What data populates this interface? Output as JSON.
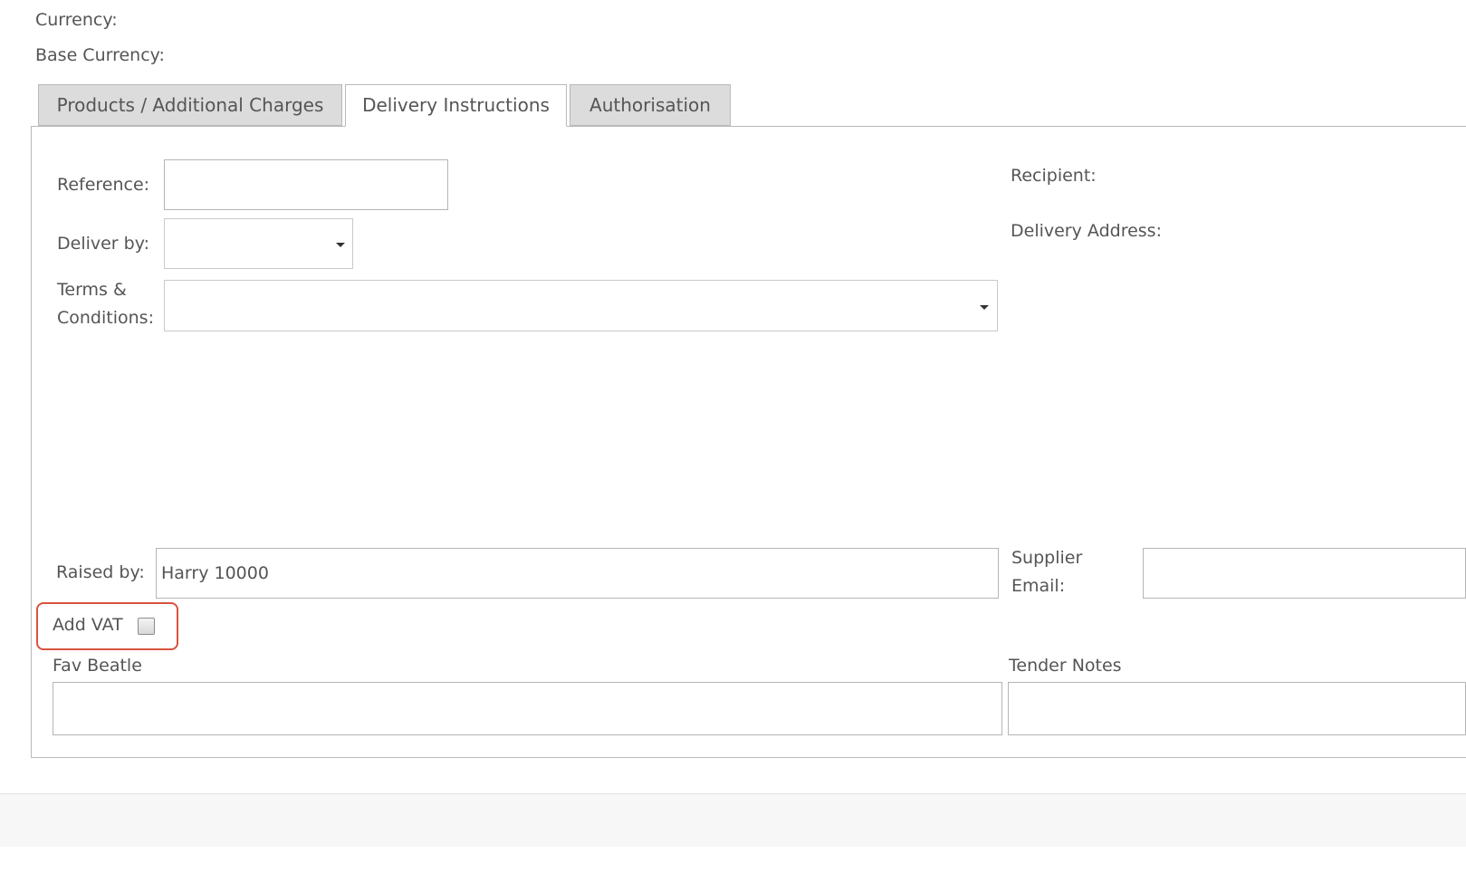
{
  "header": {
    "currency_label": "Currency:",
    "base_currency_label": "Base Currency:"
  },
  "tabs": [
    {
      "label": "Products / Additional Charges",
      "active": false
    },
    {
      "label": "Delivery Instructions",
      "active": true
    },
    {
      "label": "Authorisation",
      "active": false
    }
  ],
  "delivery": {
    "reference_label": "Reference:",
    "reference_value": "",
    "deliver_by_label": "Deliver by:",
    "deliver_by_value": "",
    "terms_label": "Terms & Conditions:",
    "terms_value": "",
    "recipient_label": "Recipient:",
    "delivery_address_label": "Delivery Address:",
    "raised_by_label": "Raised by:",
    "raised_by_value": "Harry 10000",
    "supplier_email_label": "Supplier Email:",
    "supplier_email_value": "",
    "add_vat_label": "Add VAT",
    "add_vat_checked": false,
    "fav_beatle_label": "Fav Beatle",
    "fav_beatle_value": "",
    "tender_notes_label": "Tender Notes",
    "tender_notes_value": ""
  },
  "colors": {
    "highlight": "#d9533e",
    "tab_inactive": "#dcdcdc",
    "border": "#b9b9b9",
    "text": "#555555"
  }
}
